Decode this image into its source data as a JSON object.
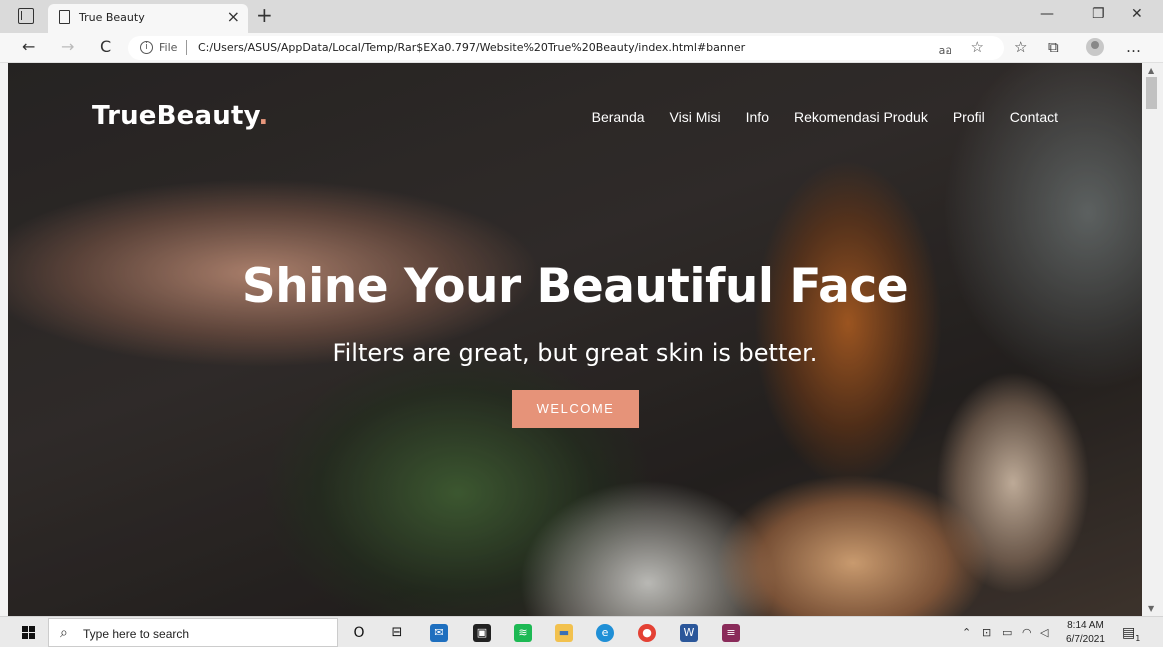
{
  "browser": {
    "tab_title": "True Beauty",
    "tab_close": "×",
    "new_tab": "+",
    "window_controls": {
      "minimize": "—",
      "restore": "❐",
      "close": "✕"
    },
    "nav": {
      "back": "←",
      "forward": "→",
      "refresh": "C"
    },
    "address": {
      "scheme": "File",
      "url": "C:/Users/ASUS/AppData/Local/Temp/Rar$EXa0.797/Website%20True%20Beauty/index.html#banner",
      "read_aloud": "aอ"
    },
    "toolbar_icons": [
      "favorites-icon",
      "collections-icon",
      "profile-icon",
      "more-icon"
    ],
    "more": "…"
  },
  "site": {
    "brand": "TrueBeauty",
    "brand_dot": ".",
    "nav": [
      "Beranda",
      "Visi Misi",
      "Info",
      "Rekomendasi Produk",
      "Profil",
      "Contact"
    ],
    "hero_title": "Shine Your Beautiful Face",
    "hero_subtitle": "Filters are great, but great skin is better.",
    "cta": "WELCOME"
  },
  "taskbar": {
    "search_placeholder": "Type here to search",
    "pinned": [
      "cortana-icon",
      "task-view-icon",
      "mail-icon",
      "store-icon",
      "spotify-icon",
      "file-explorer-icon",
      "edge-icon",
      "chrome-icon",
      "word-icon",
      "winrar-icon"
    ],
    "time": "8:14 AM",
    "date": "6/7/2021",
    "notification_count": "1"
  },
  "colors": {
    "accent": "#e69379",
    "brand_dot": "#e8977c"
  }
}
